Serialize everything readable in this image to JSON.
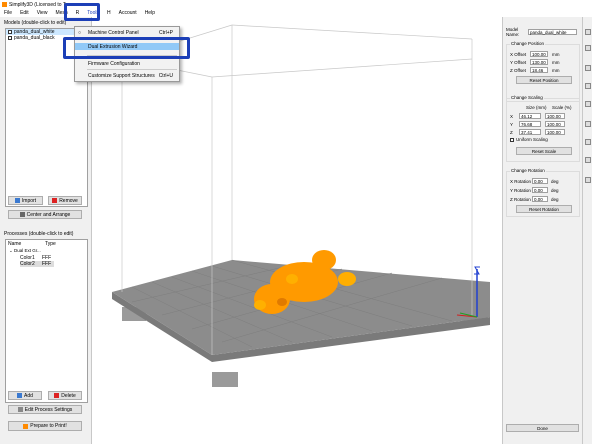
{
  "window": {
    "title": "Simplify3D (Licensed to Ter"
  },
  "menu": [
    "File",
    "Edit",
    "View",
    "Mesh",
    "R",
    "Tools",
    "H",
    "Account",
    "Help"
  ],
  "tools_menu": [
    {
      "label": "Machine Control Panel",
      "shortcut": "Ctrl+P"
    },
    {
      "label": "Dual Extrusion Wizard",
      "shortcut": ""
    },
    {
      "label": "Firmware Configuration",
      "shortcut": ""
    },
    {
      "label": "Customize Support Structures",
      "shortcut": "Ctrl+U"
    }
  ],
  "models": {
    "label": "Models (double-click to edit)",
    "items": [
      "panda_dual_white",
      "panda_dual_black"
    ],
    "import_label": "Import",
    "remove_label": "Remove",
    "center_label": "Center and Arrange"
  },
  "processes": {
    "label": "Processes (double-click to edit)",
    "col_name": "Name",
    "col_type": "Type",
    "group": "Dual Ext Gr...",
    "rows": [
      {
        "name": "Color1",
        "type": "FFF"
      },
      {
        "name": "Color2",
        "type": "FFF"
      }
    ],
    "add_label": "Add",
    "delete_label": "Delete",
    "edit_label": "Edit Process Settings",
    "prepare_label": "Prepare to Print!"
  },
  "right": {
    "model_name_label": "Model Name:",
    "model_name": "panda_dual_white",
    "position": {
      "title": "Change Position",
      "x_label": "X Offset",
      "x": "100.00",
      "y_label": "Y Offset",
      "y": "130.00",
      "z_label": "Z Offset",
      "z": "18.46",
      "unit": "mm",
      "reset": "Reset Position"
    },
    "scaling": {
      "title": "Change Scaling",
      "size_header": "Size (mm)",
      "scale_header": "Scale (%)",
      "rows": [
        {
          "axis": "X",
          "size": "46.12",
          "scale": "100.00"
        },
        {
          "axis": "Y",
          "size": "76.68",
          "scale": "100.00"
        },
        {
          "axis": "Z",
          "size": "37.41",
          "scale": "100.00"
        }
      ],
      "uniform": "Uniform Scaling",
      "reset": "Reset Scale"
    },
    "rotation": {
      "title": "Change Rotation",
      "x_label": "X Rotation",
      "x": "0.00",
      "y_label": "Y Rotation",
      "y": "0.00",
      "z_label": "Z Rotation",
      "z": "0.00",
      "unit": "deg",
      "reset": "Reset Rotation"
    },
    "done": "Done"
  },
  "colors": {
    "accent": "#1c3fb7",
    "model": "#ff9a00",
    "bed": "#8c8c8c",
    "highlight": "#91c9f7"
  }
}
